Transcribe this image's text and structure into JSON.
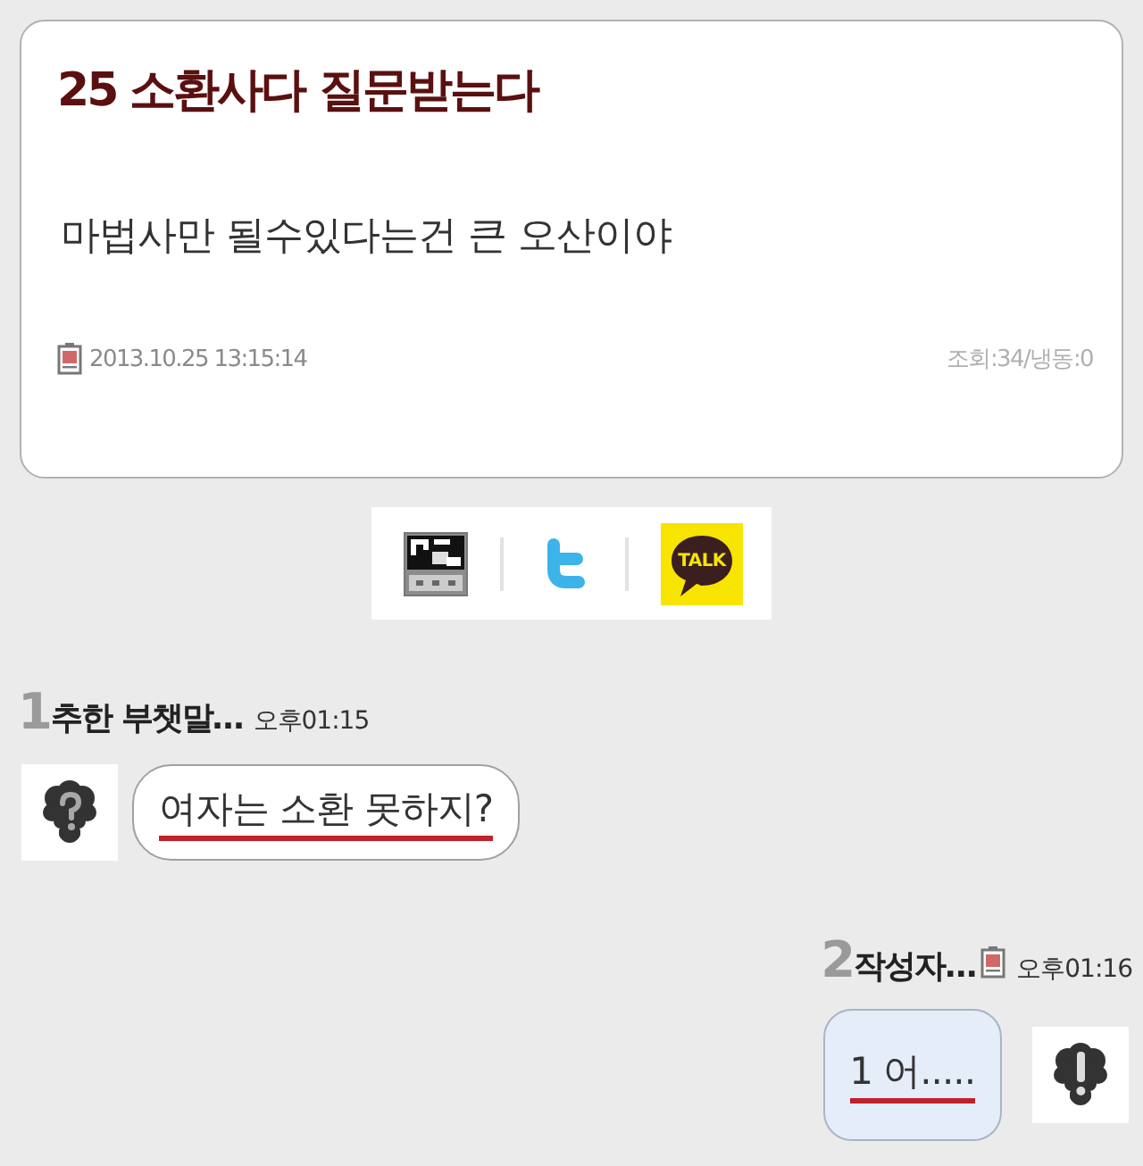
{
  "post": {
    "title": "25 소환사다 질문받는다",
    "body": "마법사만 될수있다는건 큰 오산이야",
    "date": "2013.10.25 13:15:14",
    "stats": "조회:34/냉동:0"
  },
  "share": [
    {
      "kind": "pc"
    },
    {
      "kind": "twitter"
    },
    {
      "kind": "kakao",
      "label": "TALK"
    }
  ],
  "comments": [
    {
      "kind": "guest",
      "number": "1",
      "author": "추한 부챗말…",
      "time": "오후01:15",
      "text": "여자는 소환 못하지?"
    },
    {
      "kind": "writer",
      "number": "2",
      "author": "작성자…",
      "time": "오후01:16",
      "text": "1 어....."
    }
  ]
}
